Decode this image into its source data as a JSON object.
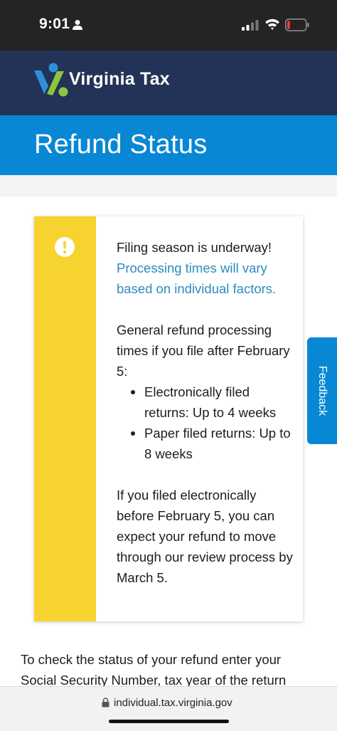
{
  "status_bar": {
    "time": "9:01"
  },
  "header": {
    "logo_text": "Virginia Tax"
  },
  "page": {
    "title": "Refund Status"
  },
  "alert": {
    "heading": "Filing season is underway!",
    "link_text": "Processing times will vary based on individual factors.",
    "intro": "General refund processing times if you file after February 5:",
    "items": [
      "Electronically filed returns: Up to 4 weeks",
      "Paper filed returns: Up to 8 weeks"
    ],
    "note": "If you filed electronically before February 5, you can expect your refund to move through our review process by March 5."
  },
  "feedback": {
    "label": "Feedback"
  },
  "body": {
    "intro": "To check the status of your refund enter your Social Security Number, tax year of the return"
  },
  "browser": {
    "url": "individual.tax.virginia.gov"
  },
  "colors": {
    "header_bg": "#233257",
    "accent_blue": "#0887d4",
    "alert_yellow": "#f7d32f",
    "link_blue": "#2a8cbf"
  }
}
